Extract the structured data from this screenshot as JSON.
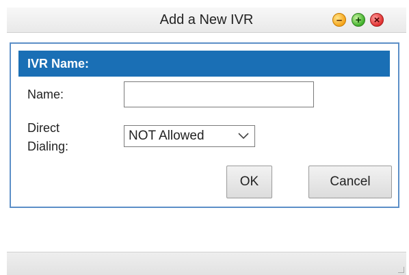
{
  "window": {
    "title": "Add a New IVR",
    "controls": [
      "minimize-icon",
      "maximize-icon",
      "close-icon"
    ],
    "colors": {
      "minimize": "#f5a31a",
      "maximize": "#3fb02a",
      "close": "#e0302f"
    }
  },
  "panel": {
    "header": "IVR Name:",
    "header_color": "#1a6fb5",
    "border_color": "#5b8ec7"
  },
  "form": {
    "name_label": "Name:",
    "name_value": "",
    "direct_dialing_label_line1": "Direct",
    "direct_dialing_label_line2": "Dialing:",
    "direct_dialing_value": "NOT Allowed"
  },
  "buttons": {
    "ok_label": "OK",
    "cancel_label": "Cancel"
  }
}
